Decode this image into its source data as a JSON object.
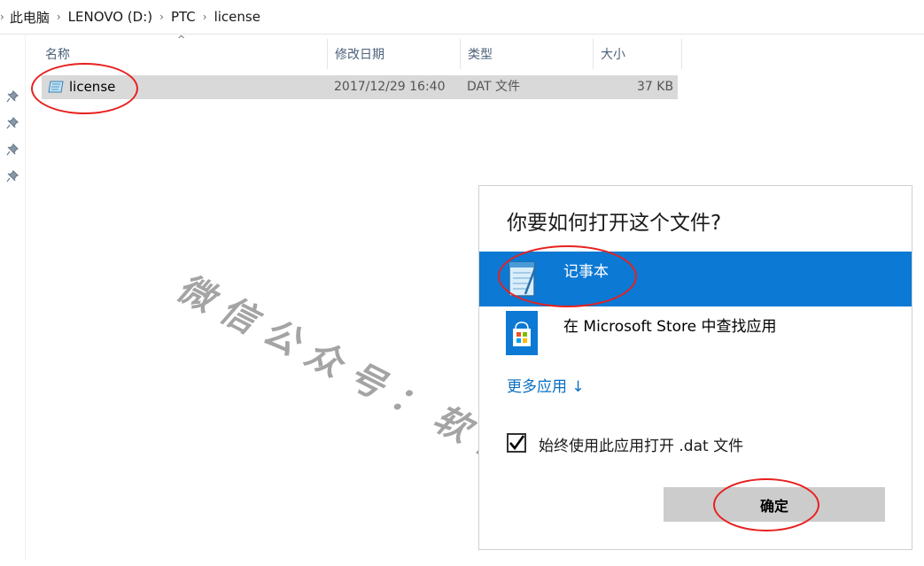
{
  "breadcrumb": {
    "items": [
      "此电脑",
      "LENOVO (D:)",
      "PTC",
      "license"
    ]
  },
  "columns": {
    "name": "名称",
    "modified": "修改日期",
    "type": "类型",
    "size": "大小"
  },
  "files": [
    {
      "name": "license",
      "modified": "2017/12/29 16:40",
      "type": "DAT 文件",
      "size": "37 KB"
    }
  ],
  "watermark": "微信公众号：软件安装大神",
  "dialog": {
    "title": "你要如何打开这个文件?",
    "apps": [
      {
        "label": "记事本",
        "icon": "notepad-icon",
        "selected": true
      },
      {
        "label": "在 Microsoft Store 中查找应用",
        "icon": "store-icon",
        "selected": false
      }
    ],
    "more_apps": "更多应用 ↓",
    "always_use_label": "始终使用此应用打开 .dat 文件",
    "always_use_checked": true,
    "ok_label": "确定"
  },
  "colors": {
    "accent": "#0c79d4",
    "highlight_ellipse": "#e8201f",
    "selected_row": "#d9d9d9"
  }
}
